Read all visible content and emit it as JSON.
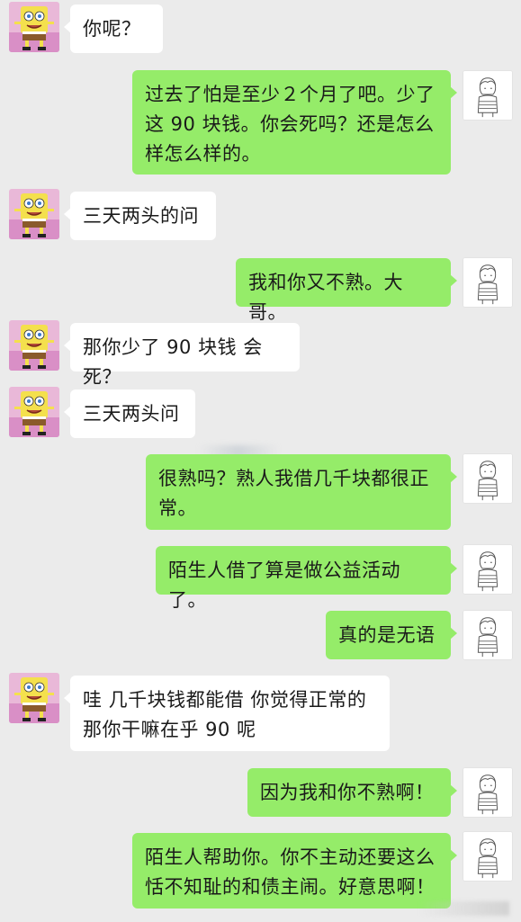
{
  "chat": {
    "messages": [
      {
        "from": "other",
        "text": "你呢？"
      },
      {
        "from": "me",
        "text": "过去了怕是至少２个月了吧。少了这 90 块钱。你会死吗？还是怎么样怎么样的。"
      },
      {
        "from": "other",
        "text": "三天两头的问"
      },
      {
        "from": "me",
        "text": "我和你又不熟。大哥。"
      },
      {
        "from": "other",
        "text": "那你少了 90 块钱 会死？"
      },
      {
        "from": "other",
        "text": "三天两头问"
      },
      {
        "from": "me",
        "text": "很熟吗？熟人我借几千块都很正常。"
      },
      {
        "from": "me",
        "text": "陌生人借了算是做公益活动了。"
      },
      {
        "from": "me",
        "text": "真的是无语"
      },
      {
        "from": "other",
        "text": "哇 几千块钱都能借 你觉得正常的那你干嘛在乎 90 呢"
      },
      {
        "from": "me",
        "text": "因为我和你不熟啊！"
      },
      {
        "from": "me",
        "text": "陌生人帮助你。你不主动还要这么恬不知耻的和债主闹。好意思啊！"
      }
    ]
  },
  "avatars": {
    "other": "spongebob-avatar",
    "me": "sketch-boy-avatar"
  },
  "colors": {
    "background": "#ebebeb",
    "bubble_me": "#95ec69",
    "bubble_other": "#ffffff"
  }
}
